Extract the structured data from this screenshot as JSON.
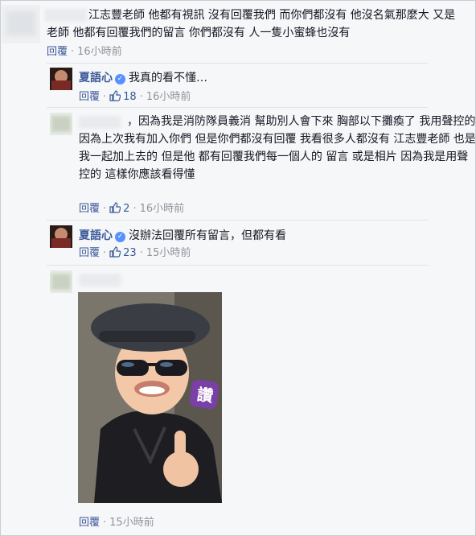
{
  "comments": [
    {
      "text": "江志豐老師 他都有視訊 沒有回覆我們 而你們都沒有 他沒名氣那麼大 又是老師 他都有回覆我們的留言 你們都沒有 人一隻小蜜蜂也沒有",
      "reply_label": "回覆",
      "time": "16小時前"
    },
    {
      "author": "夏語心",
      "text": "我真的看不懂…",
      "reply_label": "回覆",
      "likes": "18",
      "time": "16小時前"
    },
    {
      "text": "，因為我是消防隊員義消 幫助別人會下來 胸部以下攤瘓了 我用聲控的 因為上次我有加入你們 但是你們都沒有回覆 我看很多人都沒有 江志豐老師 也是我一起加上去的 但是他 都有回覆我們每一個人的 留言 或是相片 因為我是用聲控的 這樣你應該看得懂",
      "reply_label": "回覆",
      "likes": "2",
      "time": "16小時前"
    },
    {
      "author": "夏語心",
      "text": "沒辦法回覆所有留言，但都有看",
      "reply_label": "回覆",
      "likes": "23",
      "time": "15小時前"
    },
    {
      "reply_label": "回覆",
      "time": "15小時前",
      "photo_stamp": "讚"
    }
  ],
  "colors": {
    "link": "#3b5998",
    "meta": "#90949c",
    "background": "#f6f7f9",
    "verified": "#5890ff"
  },
  "icons": [
    "thumbs-up-icon",
    "verified-badge-icon"
  ]
}
